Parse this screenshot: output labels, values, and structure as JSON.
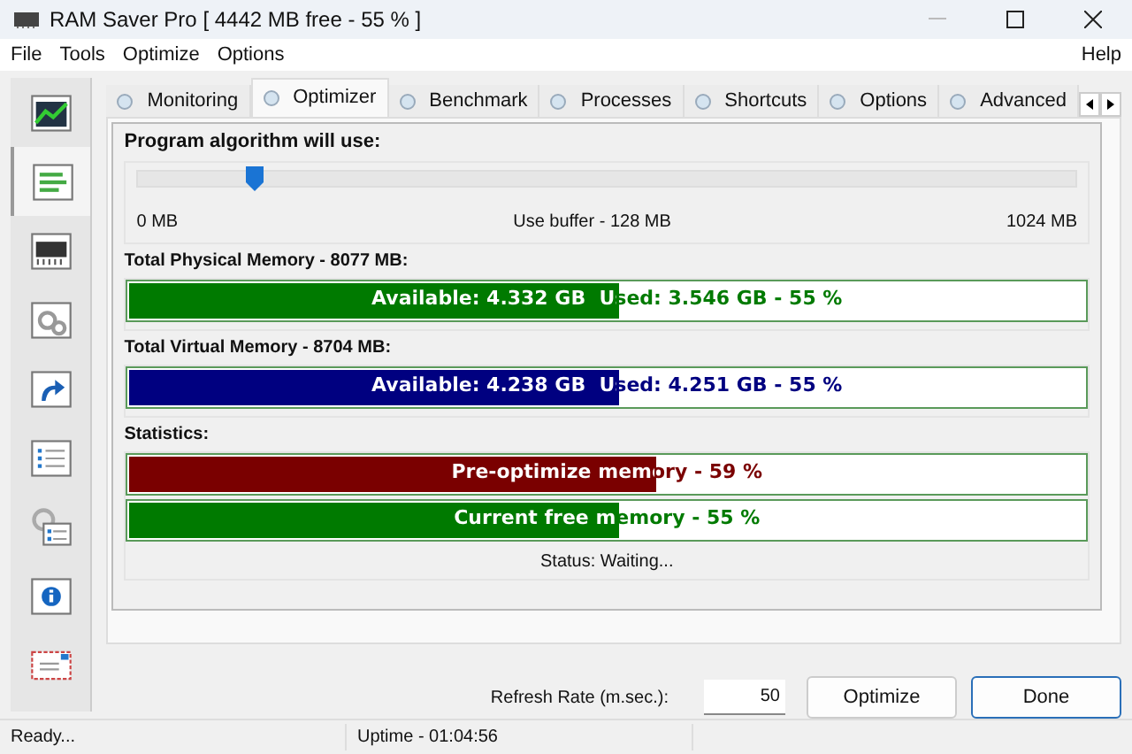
{
  "window": {
    "title": "RAM Saver Pro [ 4442 MB free - 55 % ]"
  },
  "menu": {
    "left": [
      "File",
      "Tools",
      "Optimize",
      "Options"
    ],
    "right": [
      "Help"
    ]
  },
  "sidebar": [
    {
      "kind": "chart",
      "selected": false
    },
    {
      "kind": "bars",
      "selected": true
    },
    {
      "kind": "chip",
      "selected": false
    },
    {
      "kind": "gears",
      "selected": false
    },
    {
      "kind": "shortcut",
      "selected": false
    },
    {
      "kind": "checklist",
      "selected": false
    },
    {
      "kind": "gearlist",
      "selected": false
    },
    {
      "kind": "info",
      "selected": false
    },
    {
      "kind": "mail",
      "selected": false
    }
  ],
  "tabs": [
    {
      "label": "Monitoring",
      "selected": false
    },
    {
      "label": "Optimizer",
      "selected": true
    },
    {
      "label": "Benchmark",
      "selected": false
    },
    {
      "label": "Processes",
      "selected": false
    },
    {
      "label": "Shortcuts",
      "selected": false
    },
    {
      "label": "Options",
      "selected": false
    },
    {
      "label": "Advanced",
      "selected": false
    }
  ],
  "algorithm": {
    "heading": "Program algorithm will use:",
    "level": 0.125,
    "min": "0 MB",
    "reading": "Use buffer - 128 MB",
    "max": "1024 MB"
  },
  "meters": [
    {
      "heading": "Total Physical Memory - 8077 MB:",
      "text": "Available: 4.332 GB  Used: 3.546 GB - 55 %",
      "level": 0.51,
      "color": "#007a00"
    },
    {
      "heading": "Total Virtual Memory - 8704 MB:",
      "text": "Available: 4.238 GB  Used: 4.251 GB - 55 %",
      "level": 0.51,
      "color": "#000080"
    }
  ],
  "statistics": {
    "heading": "Statistics:",
    "bars": [
      {
        "text": "Pre-optimize memory - 59 %",
        "level": 0.55,
        "color": "#7a0000"
      },
      {
        "text": "Current free memory - 55 %",
        "level": 0.51,
        "color": "#007a00"
      }
    ],
    "status": "Status: Waiting..."
  },
  "refresh": {
    "label": "Refresh Rate (m.sec.):",
    "value": "50"
  },
  "buttons": [
    "Optimize",
    "Done"
  ],
  "status_bar": [
    "Ready...",
    "Uptime - 01:04:56"
  ]
}
